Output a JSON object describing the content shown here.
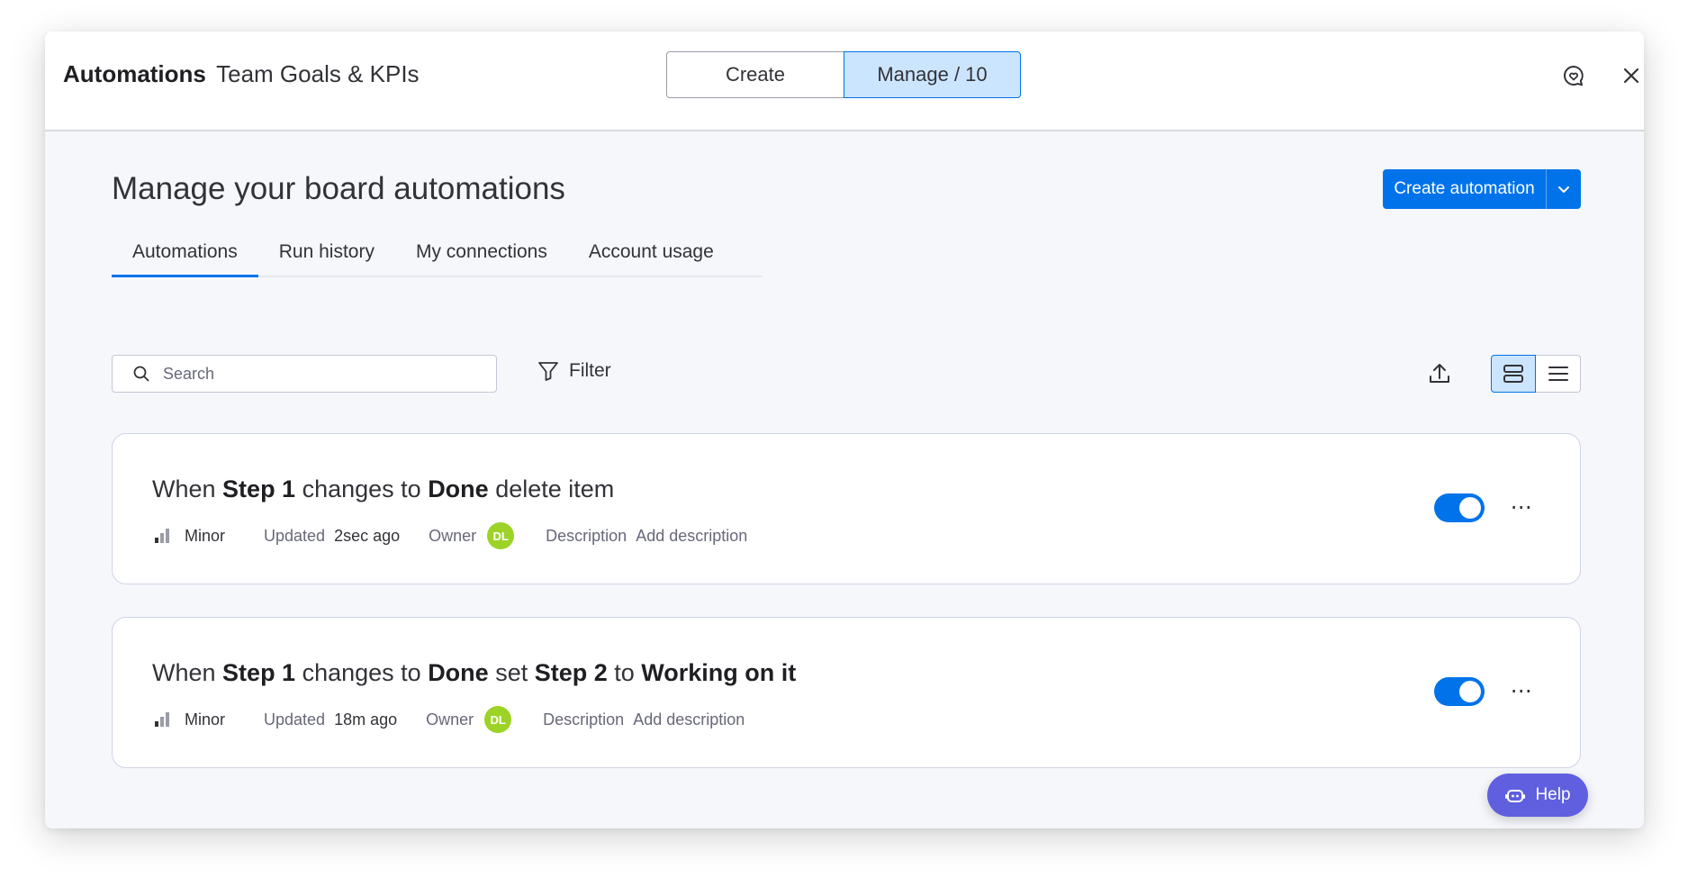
{
  "header": {
    "app_title": "Automations",
    "board_name": "Team Goals & KPIs",
    "seg_create": "Create",
    "seg_manage": "Manage / 10"
  },
  "page": {
    "title": "Manage your board automations",
    "create_button": "Create automation"
  },
  "tabs": [
    {
      "label": "Automations",
      "active": true
    },
    {
      "label": "Run history",
      "active": false
    },
    {
      "label": "My connections",
      "active": false
    },
    {
      "label": "Account usage",
      "active": false
    }
  ],
  "toolbar": {
    "search_placeholder": "Search",
    "filter_label": "Filter"
  },
  "automations": [
    {
      "parts": [
        "When ",
        "Step 1",
        " changes to ",
        "Done",
        " delete item"
      ],
      "priority": "Minor",
      "updated_label": "Updated",
      "updated_value": "2sec ago",
      "owner_label": "Owner",
      "owner_initials": "DL",
      "description_label": "Description",
      "description_value": "Add description",
      "enabled": true
    },
    {
      "parts": [
        "When ",
        "Step 1",
        " changes to ",
        "Done",
        " set ",
        "Step 2",
        " to ",
        "Working on it"
      ],
      "priority": "Minor",
      "updated_label": "Updated",
      "updated_value": "18m ago",
      "owner_label": "Owner",
      "owner_initials": "DL",
      "description_label": "Description",
      "description_value": "Add description",
      "enabled": true
    }
  ],
  "help": {
    "label": "Help"
  },
  "colors": {
    "primary": "#0073ea",
    "selected_bg": "#cce5ff",
    "avatar": "#9cd326",
    "help": "#5f5fe0"
  }
}
